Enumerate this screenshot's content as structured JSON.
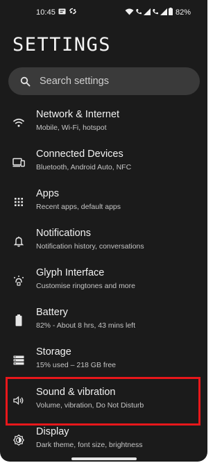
{
  "status_bar": {
    "time": "10:45",
    "battery": "82%"
  },
  "page_title": "SETTINGS",
  "search": {
    "placeholder": "Search settings"
  },
  "items": [
    {
      "title": "Network & Internet",
      "subtitle": "Mobile, Wi-Fi, hotspot",
      "icon": "wifi-icon"
    },
    {
      "title": "Connected Devices",
      "subtitle": "Bluetooth, Android Auto, NFC",
      "icon": "connected-devices-icon"
    },
    {
      "title": "Apps",
      "subtitle": "Recent apps, default apps",
      "icon": "apps-grid-icon"
    },
    {
      "title": "Notifications",
      "subtitle": "Notification history, conversations",
      "icon": "bell-icon"
    },
    {
      "title": "Glyph Interface",
      "subtitle": "Customise ringtones and more",
      "icon": "glyph-icon"
    },
    {
      "title": "Battery",
      "subtitle": "82% - About 8 hrs, 43 mins left",
      "icon": "battery-icon"
    },
    {
      "title": "Storage",
      "subtitle": "15% used – 218 GB free",
      "icon": "storage-icon"
    },
    {
      "title": "Sound & vibration",
      "subtitle": "Volume, vibration, Do Not Disturb",
      "icon": "speaker-icon"
    },
    {
      "title": "Display",
      "subtitle": "Dark theme, font size, brightness",
      "icon": "display-icon"
    }
  ],
  "highlighted_item": "Sound & vibration",
  "colors": {
    "background": "#1b1b1b",
    "search_bg": "#3a3a3a",
    "text_primary": "#f2f2f2",
    "text_secondary": "#c6c6c6",
    "highlight": "#e8171b"
  }
}
